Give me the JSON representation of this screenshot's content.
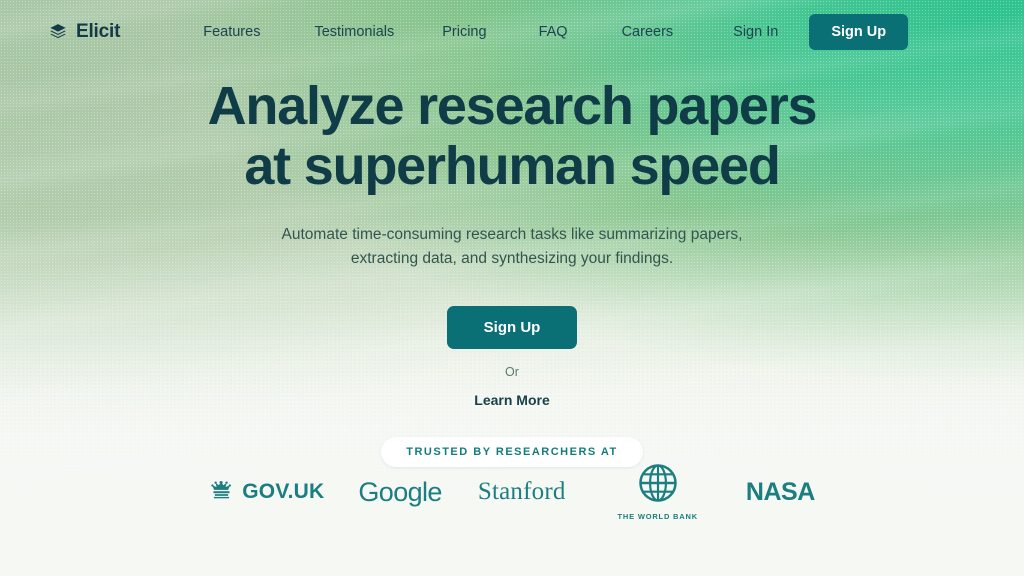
{
  "brand": {
    "name": "Elicit",
    "icon": "stacked-layers-icon"
  },
  "nav": {
    "links": [
      {
        "label": "Features"
      },
      {
        "label": "Testimonials"
      },
      {
        "label": "Pricing"
      },
      {
        "label": "FAQ"
      },
      {
        "label": "Careers"
      },
      {
        "label": "Sign In"
      }
    ],
    "cta_label": "Sign Up"
  },
  "hero": {
    "headline_line1": "Analyze research papers",
    "headline_line2": "at superhuman speed",
    "subhead_line1": "Automate time-consuming research tasks like summarizing",
    "subhead_line2": "papers, extracting data, and synthesizing your findings.",
    "cta_label": "Sign Up",
    "or_label": "Or",
    "secondary_cta_label": "Learn More",
    "trusted_label": "TRUSTED BY RESEARCHERS AT"
  },
  "logos": [
    {
      "name": "GOV.UK",
      "icon": "crown-icon"
    },
    {
      "name": "Google",
      "icon": "google-wordmark"
    },
    {
      "name": "Stanford",
      "icon": "stanford-wordmark"
    },
    {
      "name": "THE WORLD BANK",
      "icon": "globe-icon"
    },
    {
      "name": "NASA",
      "icon": "nasa-worm-wordmark"
    }
  ],
  "colors": {
    "accent_dark_teal": "#0b6f76",
    "logo_teal": "#1b7e80",
    "headline": "#103c48",
    "gradient_top_right": "#2fc490",
    "gradient_top_left": "#a6c6a4",
    "gradient_bottom": "#f6f8f4"
  }
}
